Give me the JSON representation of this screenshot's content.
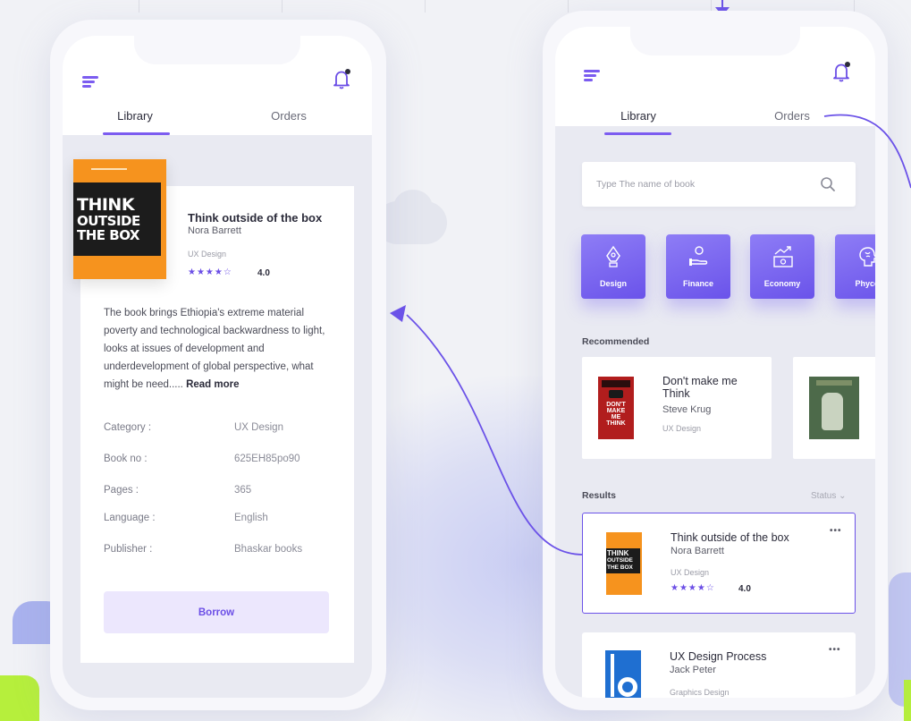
{
  "colors": {
    "accent": "#6b4ee6",
    "accent_light": "#ece7fd",
    "connector": "#6b52e8",
    "book_orange": "#f6931e"
  },
  "detail_phone": {
    "menu_icon": "menu-icon",
    "bell_icon": "bell-icon",
    "tabs": [
      {
        "label": "Library",
        "active": true
      },
      {
        "label": "Orders",
        "active": false
      }
    ],
    "cover": {
      "lines": [
        "THINK",
        "OUTSIDE",
        "THE BOX"
      ]
    },
    "book": {
      "title": "Think outside of the box",
      "author": "Nora Barrett",
      "category": "UX Design",
      "stars": "★★★★☆",
      "rating": "4.0"
    },
    "description": "The book brings Ethiopia's extreme material poverty and technological backwardness to light, looks at issues of development and underdevelopment of global perspective, what might be need.....",
    "read_more": "Read more",
    "info": [
      {
        "label": "Category :",
        "value": "UX Design"
      },
      {
        "label": "Book no :",
        "value": "625EH85po90"
      },
      {
        "label": "Pages :",
        "value": "365"
      },
      {
        "label": "Language :",
        "value": "English"
      },
      {
        "label": "Publisher :",
        "value": "Bhaskar books"
      }
    ],
    "borrow_label": "Borrow"
  },
  "list_phone": {
    "menu_icon": "menu-icon",
    "bell_icon": "bell-icon",
    "tabs": [
      {
        "label": "Library",
        "active": true
      },
      {
        "label": "Orders",
        "active": false
      }
    ],
    "search": {
      "placeholder": "Type The name of book",
      "icon": "search-icon"
    },
    "categories": [
      {
        "label": "Design",
        "icon": "pen-nib-icon"
      },
      {
        "label": "Finance",
        "icon": "hand-coin-icon"
      },
      {
        "label": "Economy",
        "icon": "money-trend-icon"
      },
      {
        "label": "Phyco",
        "icon": "brain-icon"
      }
    ],
    "recommended_label": "Recommended",
    "recommended": [
      {
        "title": "Don't make me Think",
        "author": "Steve Krug",
        "category": "UX Design",
        "cover_lines": [
          "DON'T",
          "MAKE",
          "ME",
          "THINK"
        ]
      },
      {
        "title": "",
        "author": "",
        "category": ""
      }
    ],
    "results_label": "Results",
    "status_label": "Status ⌄",
    "results": [
      {
        "title": "Think outside of the box",
        "author": "Nora Barrett",
        "category": "UX Design",
        "stars": "★★★★☆",
        "rating": "4.0",
        "more": "•••",
        "cover_lines": [
          "THINK",
          "OUTSIDE",
          "THE BOX"
        ]
      },
      {
        "title": "UX Design Process",
        "author": "Jack Peter",
        "category": "Graphics Design",
        "more": "•••"
      }
    ]
  }
}
